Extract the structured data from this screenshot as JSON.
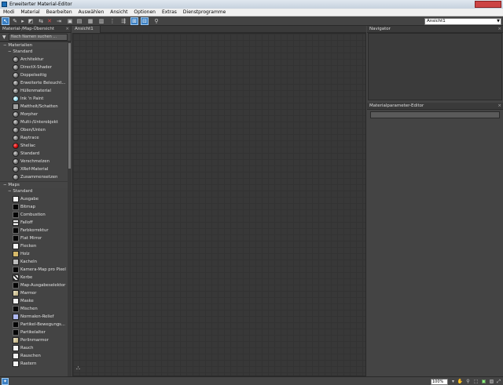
{
  "window": {
    "title": "Erweiterter Material-Editor"
  },
  "menu": [
    "Modi",
    "Material",
    "Bearbeiten",
    "Auswählen",
    "Ansicht",
    "Optionen",
    "Extras",
    "Dienstprogramme"
  ],
  "toolbar": {
    "view_select": "Ansicht1"
  },
  "browser": {
    "header": "Material-/Map-Übersicht",
    "search_placeholder": "Nach Namen suchen ...",
    "materials_group": "Materialien",
    "materials_sub": "Standard",
    "materials": [
      {
        "label": "Architektur",
        "swatch": "sphere"
      },
      {
        "label": "DirectX-Shader",
        "swatch": "sphere"
      },
      {
        "label": "Doppelseitig",
        "swatch": "sphere"
      },
      {
        "label": "Erweiterte Beleucht...",
        "swatch": "sphere"
      },
      {
        "label": "Hüllenmaterial",
        "swatch": "sphere"
      },
      {
        "label": "Ink 'n Paint",
        "swatch": "cyan"
      },
      {
        "label": "Mattheit/Schatten",
        "swatch": "flat"
      },
      {
        "label": "Morpher",
        "swatch": "sphere"
      },
      {
        "label": "Multi-/Unterobjekt",
        "swatch": "sphere"
      },
      {
        "label": "Oben/Unten",
        "swatch": "sphere"
      },
      {
        "label": "Raytrace",
        "swatch": "sphere"
      },
      {
        "label": "Shellac",
        "swatch": "red"
      },
      {
        "label": "Standard",
        "swatch": "sphere"
      },
      {
        "label": "Verschmelzen",
        "swatch": "sphere"
      },
      {
        "label": "XRef-Material",
        "swatch": "sphere"
      },
      {
        "label": "Zusammensetzen",
        "swatch": "sphere"
      }
    ],
    "maps_group": "Maps",
    "maps_sub": "Standard",
    "maps": [
      {
        "label": "Ausgabe",
        "swatch": "white"
      },
      {
        "label": "Bitmap",
        "swatch": "black"
      },
      {
        "label": "Combustion",
        "swatch": "black"
      },
      {
        "label": "Falloff",
        "swatch": "stripe"
      },
      {
        "label": "Farbkorrektur",
        "swatch": "black"
      },
      {
        "label": "Flat Mirror",
        "swatch": "black"
      },
      {
        "label": "Flecken",
        "swatch": "white"
      },
      {
        "label": "Holz",
        "swatch": "tan"
      },
      {
        "label": "Kacheln",
        "swatch": "grey"
      },
      {
        "label": "Kamera-Map pro Pixel",
        "swatch": "black"
      },
      {
        "label": "Kerbe",
        "swatch": "check"
      },
      {
        "label": "Map-Ausgabeselektor",
        "swatch": "black"
      },
      {
        "label": "Marmor",
        "swatch": "marble"
      },
      {
        "label": "Maske",
        "swatch": "white"
      },
      {
        "label": "Mischen",
        "swatch": "black"
      },
      {
        "label": "Normalen-Relief",
        "swatch": "lightblue"
      },
      {
        "label": "Partikel-Bewegungs...",
        "swatch": "black"
      },
      {
        "label": "Partikelalter",
        "swatch": "black"
      },
      {
        "label": "Perlinmarmor",
        "swatch": "marble"
      },
      {
        "label": "Rauch",
        "swatch": "white"
      },
      {
        "label": "Rauschen",
        "swatch": "white"
      },
      {
        "label": "Rastern",
        "swatch": "white"
      }
    ]
  },
  "view": {
    "tab": "Ansicht1"
  },
  "navigator": {
    "title": "Navigator"
  },
  "param_editor": {
    "title": "Materialparameter-Editor"
  },
  "status": {
    "zoom": "100%"
  },
  "colors": {
    "accent": "#3a7fc3",
    "background": "#444444"
  }
}
